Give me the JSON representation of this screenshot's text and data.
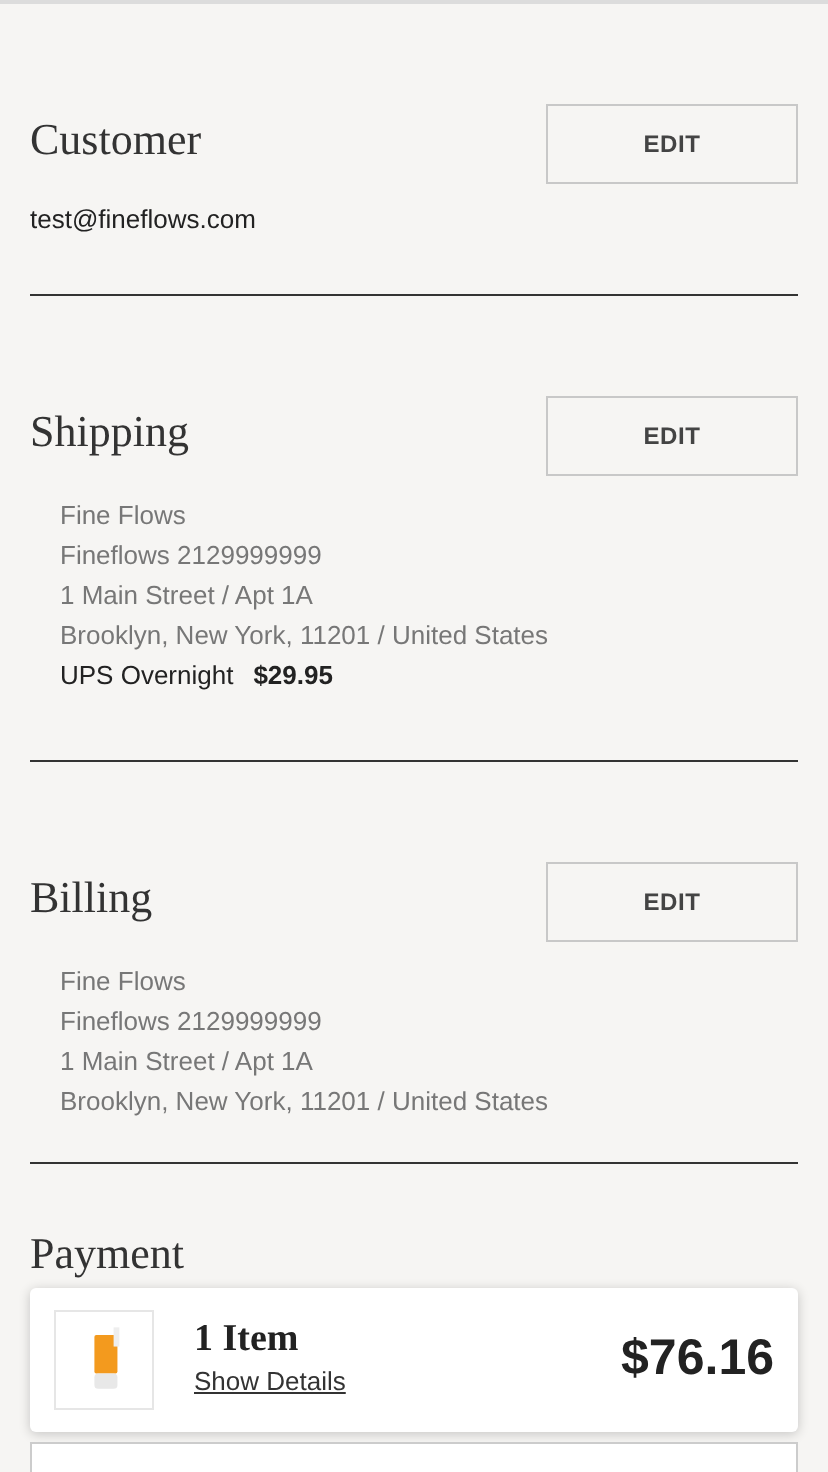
{
  "sections": [
    {
      "title": "Customer",
      "button": "EDIT",
      "kind": "plain",
      "lines": [
        "test@fineflows.com"
      ]
    },
    {
      "title": "Shipping",
      "button": "EDIT",
      "kind": "address",
      "lines": [
        "Fine Flows",
        "Fineflows 2129999999",
        "1 Main Street / Apt 1A",
        "Brooklyn, New York, 11201 / United States"
      ],
      "method": {
        "name": "UPS Overnight",
        "price": "$29.95"
      }
    },
    {
      "title": "Billing",
      "button": "EDIT",
      "kind": "address",
      "lines": [
        "Fine Flows",
        "Fineflows 2129999999",
        "1 Main Street / Apt 1A",
        "Brooklyn, New York, 11201 / United States"
      ]
    }
  ],
  "next_heading": "Payment",
  "summary": {
    "count": "1 Item",
    "link": "Show Details",
    "total": "$76.16"
  }
}
